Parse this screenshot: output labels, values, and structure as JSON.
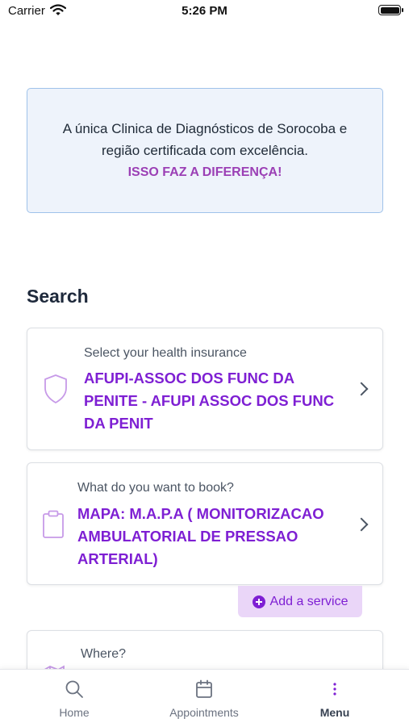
{
  "status_bar": {
    "carrier": "Carrier",
    "time": "5:26 PM"
  },
  "banner": {
    "line1": "A única Clinica de Diagnósticos de Sorocoba e",
    "line2": "região certificada com excelência.",
    "highlight": "ISSO FAZ A DIFERENÇA!"
  },
  "search": {
    "title": "Search",
    "insurance": {
      "label": "Select your health insurance",
      "value_lines": [
        "AFUPI-ASSOC DOS FUNC DA",
        "PENITE - AFUPI ASSOC DOS FUNC",
        "DA PENIT"
      ],
      "icon": "shield-icon"
    },
    "service": {
      "label": "What do you want to book?",
      "value_lines": [
        "MAPA: M.A.P.A ( MONITORIZACAO",
        "AMBULATORIAL DE PRESSAO",
        "ARTERIAL)"
      ],
      "icon": "clipboard-icon"
    },
    "add_service_label": "Add a service",
    "location": {
      "label": "Where?",
      "icon": "map-icon"
    }
  },
  "tab_bar": {
    "tabs": [
      {
        "label": "Home",
        "icon": "search-icon"
      },
      {
        "label": "Appointments",
        "icon": "calendar-icon"
      },
      {
        "label": "Menu",
        "icon": "more-vertical-icon"
      }
    ]
  },
  "colors": {
    "accent": "#7e1fd3",
    "highlight": "#9b3fb5",
    "banner_bg": "#eef3fb",
    "banner_border": "#9fc2ea",
    "add_service_bg": "#ead6f8"
  }
}
